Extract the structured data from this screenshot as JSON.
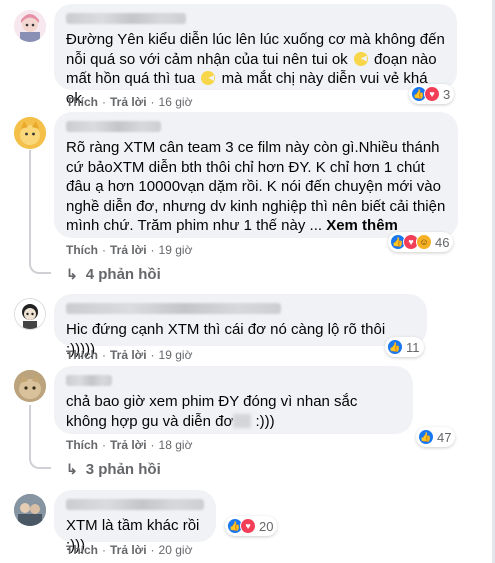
{
  "comments": [
    {
      "text_parts": [
        "Đường Yên kiểu diễn lúc lên lúc xuống cơ mà không đến nỗi quá so với cảm nhận của tui nên tui ok",
        "đoạn nào mất hồn quá thì tua",
        "mà mắt chị này diễn vui vẻ khá ok"
      ],
      "emoji": "pacman-emoji",
      "reactions": {
        "icons": [
          "like-icon",
          "love-icon"
        ],
        "count": "3"
      },
      "actions": {
        "like": "Thích",
        "reply": "Trả lời",
        "time": "16 giờ"
      }
    },
    {
      "text": "Rõ ràng XTM cân team 3 ce film này còn gì.Nhiều thánh cứ bảoXTM diễn bth thôi chỉ hơn ĐY. K chỉ hơn 1 chút đâu ạ hơn 10000vạn dặm rồi. K nói đến chuyện mới vào nghề diễn đơ, nhưng dv kinh nghiệp thì nên biết cải thiện mình chứ. Trăm phim như 1 thế này ...",
      "see_more": "Xem thêm",
      "reactions": {
        "icons": [
          "like-icon",
          "love-icon",
          "haha-icon"
        ],
        "count": "46"
      },
      "actions": {
        "like": "Thích",
        "reply": "Trả lời",
        "time": "19 giờ"
      },
      "replies": "4 phản hồi"
    },
    {
      "text": "Hic đứng cạnh XTM thì cái đơ nó càng lộ rõ thôi :)))))",
      "reactions": {
        "icons": [
          "like-icon"
        ],
        "count": "11"
      },
      "actions": {
        "like": "Thích",
        "reply": "Trả lời",
        "time": "19 giờ"
      }
    },
    {
      "text_parts": [
        "chả bao giờ xem phim ĐY đóng vì nhan sắc không hợp gu và diễn đơ",
        ":)))"
      ],
      "reactions": {
        "icons": [
          "like-icon"
        ],
        "count": "47"
      },
      "actions": {
        "like": "Thích",
        "reply": "Trả lời",
        "time": "18 giờ"
      },
      "replies": "3 phản hồi"
    },
    {
      "text": "XTM là tầm khác rồi :)))",
      "reactions": {
        "icons": [
          "like-icon",
          "love-icon"
        ],
        "count": "20"
      },
      "actions": {
        "like": "Thích",
        "reply": "Trả lời",
        "time": "20 giờ"
      }
    }
  ],
  "colors": {
    "bubble": "#f0f2f5",
    "meta_text": "#65676b",
    "like": "#1877f2",
    "love": "#f33e58",
    "haha": "#f7b125"
  }
}
